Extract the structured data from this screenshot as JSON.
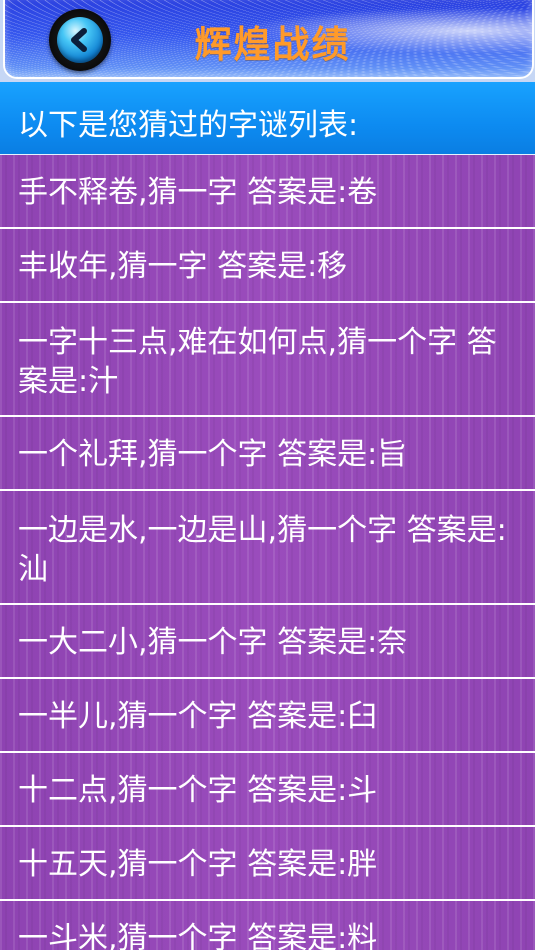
{
  "header": {
    "title": "辉煌战绩",
    "back_icon": "chevron-left-icon"
  },
  "subheader": {
    "text": "以下是您猜过的字谜列表:"
  },
  "riddles": [
    {
      "text": "手不释卷,猜一字 答案是:卷"
    },
    {
      "text": "丰收年,猜一字 答案是:移"
    },
    {
      "text": "一字十三点,难在如何点,猜一个字 答案是:汁"
    },
    {
      "text": "一个礼拜,猜一个字 答案是:旨"
    },
    {
      "text": "一边是水,一边是山,猜一个字 答案是:汕"
    },
    {
      "text": "一大二小,猜一个字 答案是:奈"
    },
    {
      "text": "一半儿,猜一个字 答案是:臼"
    },
    {
      "text": "十二点,猜一个字 答案是:斗"
    },
    {
      "text": "十五天,猜一个字 答案是:胖"
    },
    {
      "text": "一斗米,猜一个字 答案是:料"
    }
  ],
  "colors": {
    "title": "#ff9a2a",
    "subheader_bg": "#0d8bf1",
    "list_bg": "#9348b4",
    "divider": "#ffffff"
  }
}
